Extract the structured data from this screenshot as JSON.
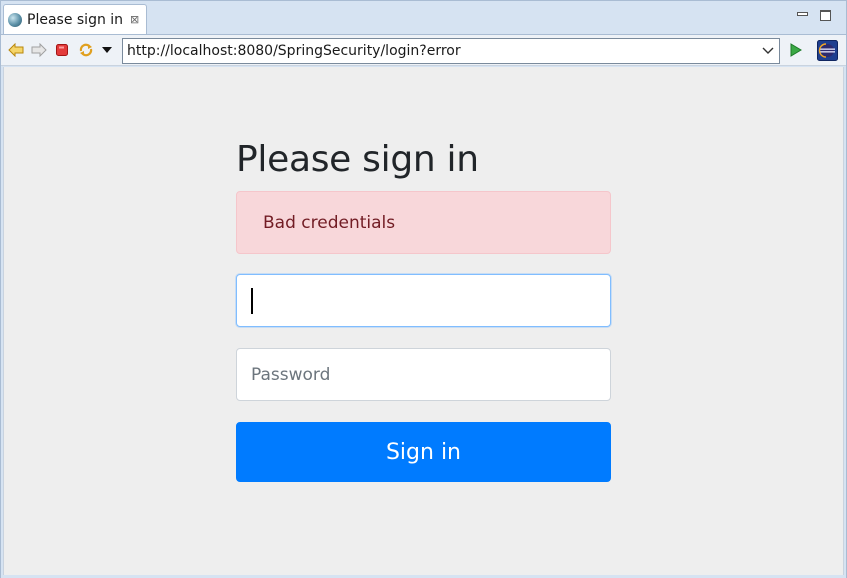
{
  "tab": {
    "label": "Please sign in",
    "close_glyph": "⊠",
    "icon": "globe-icon"
  },
  "window_controls": {
    "minimize_icon": "minimize-icon",
    "maximize_icon": "maximize-icon"
  },
  "toolbar": {
    "url": "http://localhost:8080/SpringSecurity/login?error",
    "icons": [
      "back-icon",
      "forward-icon",
      "stop-icon",
      "refresh-icon",
      "dropdown-icon",
      "go-icon",
      "eclipse-icon"
    ]
  },
  "login": {
    "heading": "Please sign in",
    "alert": "Bad credentials",
    "username_value": "",
    "password_placeholder": "Password",
    "submit_label": "Sign in"
  },
  "colors": {
    "primary": "#007bff",
    "alert_bg": "#f8d7da",
    "alert_text": "#721c24",
    "page_bg": "#eeeeee",
    "chrome_bg": "#d6e3f2"
  }
}
